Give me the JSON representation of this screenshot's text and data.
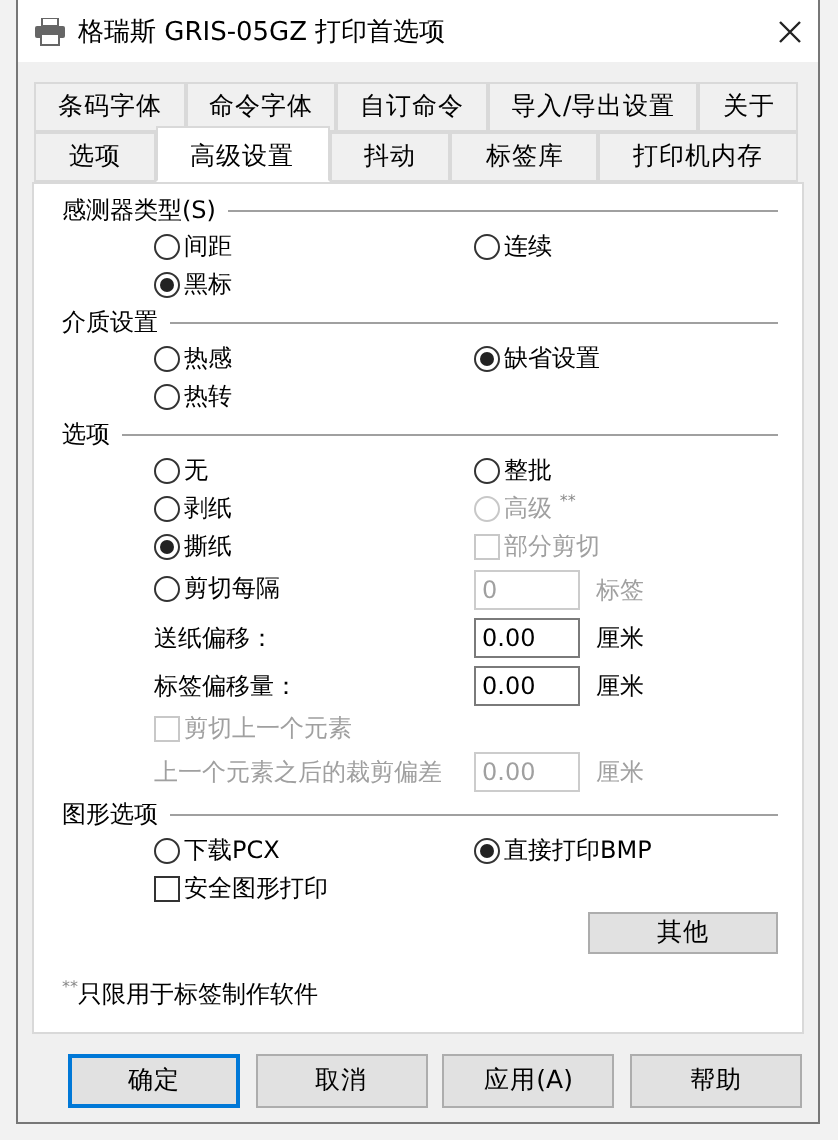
{
  "window": {
    "title": "格瑞斯  GRIS-05GZ 打印首选项"
  },
  "tab_rows": [
    {
      "tabs": [
        {
          "label": "条码字体",
          "selected": false
        },
        {
          "label": "命令字体",
          "selected": false
        },
        {
          "label": "自订命令",
          "selected": false
        },
        {
          "label": "导入/导出设置",
          "selected": false
        },
        {
          "label": "关于",
          "selected": false
        }
      ]
    },
    {
      "tabs": [
        {
          "label": "选项",
          "selected": false
        },
        {
          "label": "高级设置",
          "selected": true
        },
        {
          "label": "抖动",
          "selected": false
        },
        {
          "label": "标签库",
          "selected": false
        },
        {
          "label": "打印机内存",
          "selected": false
        }
      ]
    }
  ],
  "sections": [
    {
      "title": "感测器类型(S)",
      "rows": [
        [
          {
            "kind": "radio",
            "label": "间距",
            "selected": false,
            "disabled": false
          },
          {
            "kind": "radio",
            "label": "连续",
            "selected": false,
            "disabled": false
          }
        ],
        [
          {
            "kind": "radio",
            "label": "黑标",
            "selected": true,
            "disabled": false
          }
        ]
      ]
    },
    {
      "title": "介质设置",
      "rows": [
        [
          {
            "kind": "radio",
            "label": "热感",
            "selected": false,
            "disabled": false
          },
          {
            "kind": "radio",
            "label": "缺省设置",
            "selected": true,
            "disabled": false
          }
        ],
        [
          {
            "kind": "radio",
            "label": "热转",
            "selected": false,
            "disabled": false
          }
        ]
      ]
    },
    {
      "title": "选项",
      "rows": [
        [
          {
            "kind": "radio",
            "label": "无",
            "selected": false,
            "disabled": false
          },
          {
            "kind": "radio",
            "label": "整批",
            "selected": false,
            "disabled": false
          }
        ],
        [
          {
            "kind": "radio",
            "label": "剥纸",
            "selected": false,
            "disabled": false
          },
          {
            "kind": "radio",
            "label": "高级 $^{**}$",
            "selected": false,
            "disabled": true
          }
        ],
        [
          {
            "kind": "radio",
            "label": "撕纸",
            "selected": true,
            "disabled": false
          },
          {
            "kind": "checkbox",
            "label": "部分剪切",
            "checked": false,
            "disabled": true
          }
        ],
        [
          {
            "kind": "radio",
            "label": "剪切每隔",
            "selected": false,
            "disabled": false
          },
          {
            "kind": "input",
            "value": "0",
            "unit": "标签",
            "disabled": true
          }
        ],
        [
          {
            "kind": "text",
            "label": "送纸偏移：",
            "disabled": false
          },
          {
            "kind": "input",
            "value": "0.00",
            "unit": "厘米",
            "disabled": false
          }
        ],
        [
          {
            "kind": "text",
            "label": "标签偏移量：",
            "disabled": false
          },
          {
            "kind": "input",
            "value": "0.00",
            "unit": "厘米",
            "disabled": false
          }
        ],
        [
          {
            "kind": "checkbox",
            "label": "剪切上一个元素",
            "checked": false,
            "disabled": true
          }
        ],
        [
          {
            "kind": "text",
            "label": "上一个元素之后的裁剪偏差",
            "disabled": true
          },
          {
            "kind": "input",
            "value": "0.00",
            "unit": "厘米",
            "disabled": true
          }
        ]
      ]
    },
    {
      "title": "图形选项",
      "rows": [
        [
          {
            "kind": "radio",
            "label": "下载PCX",
            "selected": false,
            "disabled": false
          },
          {
            "kind": "radio",
            "label": "直接打印BMP",
            "selected": true,
            "disabled": false
          }
        ],
        [
          {
            "kind": "checkbox",
            "label": "安全图形打印",
            "checked": false,
            "disabled": false
          }
        ]
      ]
    }
  ],
  "other_button": "其他",
  "note": "$^{**}$只限用于标签制作软件",
  "buttons": [
    {
      "label": "确定",
      "default": true
    },
    {
      "label": "取消",
      "default": false
    },
    {
      "label": "应用(A)",
      "default": false
    },
    {
      "label": "帮助",
      "default": false
    }
  ]
}
